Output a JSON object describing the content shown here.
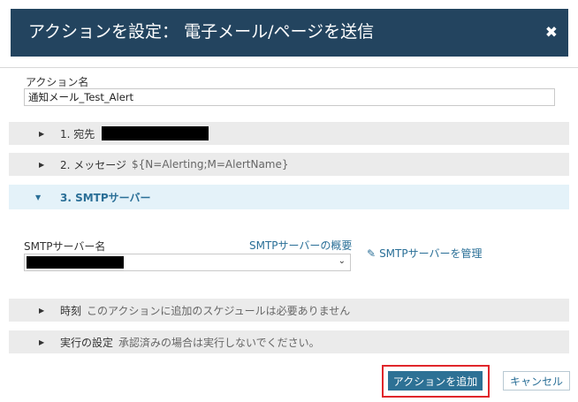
{
  "dialog": {
    "title": "アクションを設定： 電子メール/ページを送信",
    "close_icon": "✖"
  },
  "action_name": {
    "label": "アクション名",
    "value": "通知メール_Test_Alert"
  },
  "sections": {
    "recipients": {
      "caret": "▶",
      "title": "1. 宛先",
      "subtitle": ""
    },
    "message": {
      "caret": "▶",
      "title": "2. メッセージ",
      "subtitle": "${N=Alerting;M=AlertName}"
    },
    "smtp": {
      "caret": "▼",
      "title": "3. SMTPサーバー"
    },
    "time": {
      "caret": "▶",
      "title": "時刻",
      "subtitle": "このアクションに追加のスケジュールは必要ありません"
    },
    "execution": {
      "caret": "▶",
      "title": "実行の設定",
      "subtitle": "承認済みの場合は実行しないでください。"
    }
  },
  "smtp_server": {
    "label": "SMTPサーバー名",
    "overview_link": "SMTPサーバーの概要",
    "manage_link": "SMTPサーバーを管理",
    "selected_value": "",
    "dropdown_icon": "⌄",
    "edit_icon": "✎"
  },
  "buttons": {
    "add_action": "アクションを追加",
    "cancel": "キャンセル"
  },
  "colors": {
    "header_bg": "#23445f",
    "accent": "#2a6f97",
    "primary_button": "#2d7195",
    "highlight_border": "#e0262b"
  }
}
